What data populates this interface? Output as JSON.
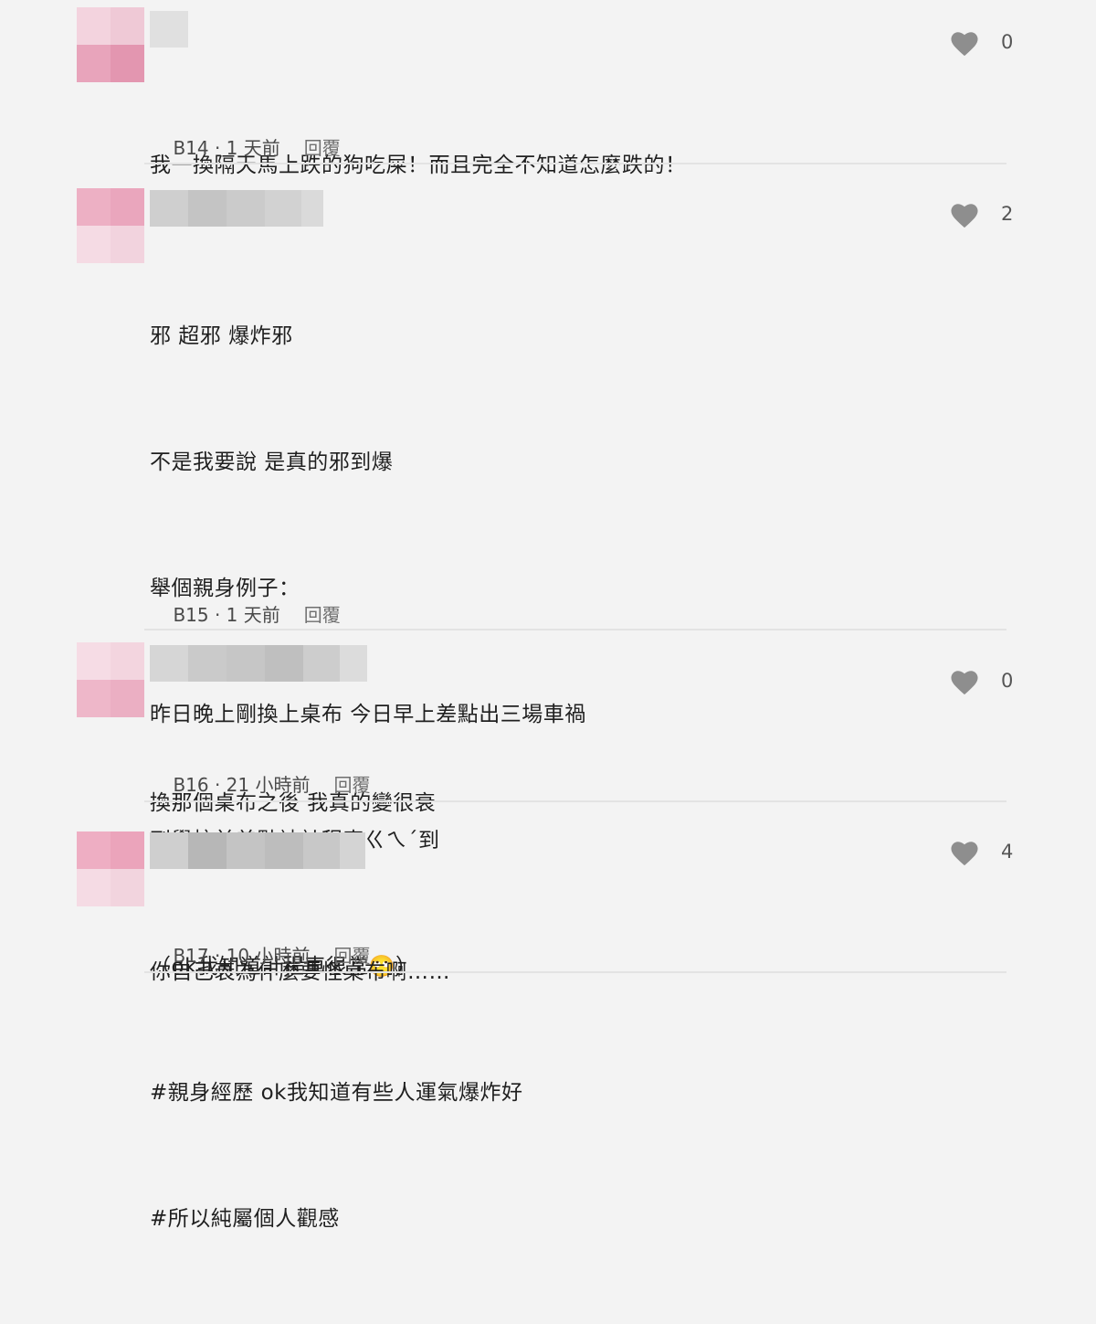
{
  "colors": {
    "background": "#f3f3f3",
    "heart": "#8e8e8e",
    "divider": "#e3e3e3"
  },
  "comments": [
    {
      "floor_time": "B14 · 1 天前",
      "reply_label": "回覆",
      "likes": "0",
      "lines": [
        "我一換隔天馬上跌的狗吃屎！而且完全不知道怎麼跌的！"
      ]
    },
    {
      "floor_time": "B15 · 1 天前",
      "reply_label": "回覆",
      "likes": "2",
      "lines": [
        "邪 超邪 爆炸邪",
        "不是我要說 是真的邪到爆",
        "舉個親身例子：",
        "昨日晚上剛換上桌布 今日早上差點出三場車禍",
        "到學校前差點被計程車ㄍㄟˊ到",
        "（ok我知道計程車很常🙄）",
        "#親身經歷 ok我知道有些人運氣爆炸好",
        "#所以純屬個人觀感"
      ]
    },
    {
      "floor_time": "B16 · 21 小時前",
      "reply_label": "回覆",
      "likes": "0",
      "lines": [
        "換那個桌布之後 我真的變很衰"
      ]
    },
    {
      "floor_time": "B17 · 10 小時前",
      "reply_label": "回覆",
      "likes": "4",
      "lines": [
        "你自己衰為什麼要怪桌布啊……"
      ]
    }
  ]
}
